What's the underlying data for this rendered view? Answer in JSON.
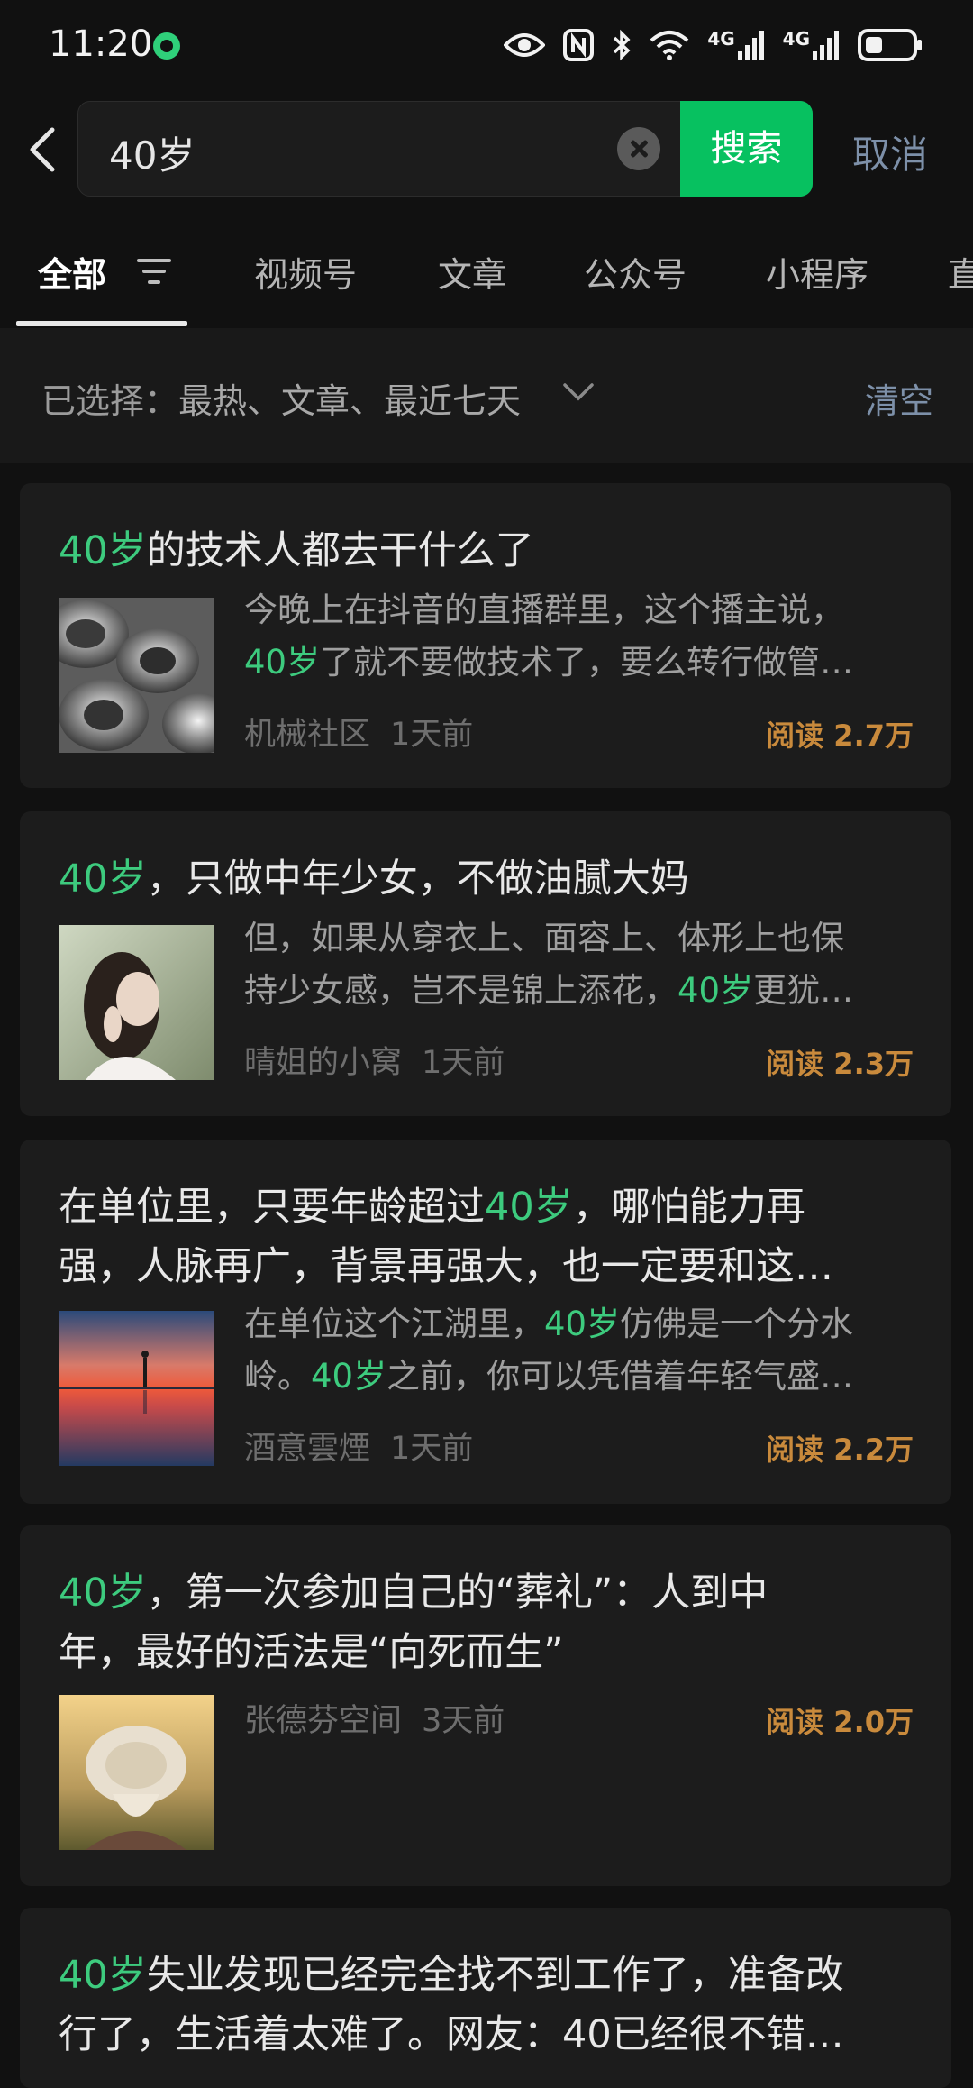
{
  "status_bar": {
    "time": "11:20",
    "network_label_1": "4G",
    "network_label_2": "4G"
  },
  "search": {
    "query": "40岁",
    "search_label": "搜索",
    "cancel_label": "取消"
  },
  "tabs": [
    {
      "label": "全部"
    },
    {
      "label": "视频号"
    },
    {
      "label": "文章"
    },
    {
      "label": "公众号"
    },
    {
      "label": "小程序"
    },
    {
      "label": "直"
    }
  ],
  "filter": {
    "prefix": "已选择：",
    "selected": "最热、文章、最近七天",
    "clear_label": "清空"
  },
  "articles": [
    {
      "title_hl": "40岁",
      "title_rest": "的技术人都去干什么了",
      "desc_line1": "今晚上在抖音的直播群里，这个播主说，",
      "desc_line2_hl": "40岁",
      "desc_line2_rest": "了就不要做技术了，要么转行做管…",
      "source": "机械社区",
      "time": "1天前",
      "reads": "阅读 2.7万"
    },
    {
      "title_hl": "40岁",
      "title_rest": "，只做中年少女，不做油腻大妈",
      "desc_line1": "但，如果从穿衣上、面容上、体形上也保",
      "desc_line2_pre": "持少女感，岂不是锦上添花，",
      "desc_line2_hl": "40岁",
      "desc_line2_rest": "更犹…",
      "source": "晴姐的小窝",
      "time": "1天前",
      "reads": "阅读 2.3万"
    },
    {
      "title_line1_pre": "在单位里，只要年龄超过",
      "title_line1_hl": "40岁",
      "title_line1_rest": "，哪怕能力再",
      "title_line2": "强，人脉再广，背景再强大，也一定要和这…",
      "desc_line1_pre": "在单位这个江湖里，",
      "desc_line1_hl": "40岁",
      "desc_line1_rest": "仿佛是一个分水",
      "desc_line2_pre": "岭。",
      "desc_line2_hl": "40岁",
      "desc_line2_rest": "之前，你可以凭借着年轻气盛…",
      "source": "酒意雲煙",
      "time": "1天前",
      "reads": "阅读 2.2万"
    },
    {
      "title_line1_hl": "40岁",
      "title_line1_rest": "，第一次参加自己的“葬礼”：人到中",
      "title_line2": "年，最好的活法是“向死而生”",
      "source": "张德芬空间",
      "time": "3天前",
      "reads": "阅读 2.0万"
    },
    {
      "title_line1_hl": "40岁",
      "title_line1_rest": "失业发现已经完全找不到工作了，准备改",
      "title_line2": "行了，生活着太难了。网友：40已经很不错…"
    }
  ],
  "colors": {
    "accent_green": "#07c160",
    "highlight_green": "#3dcb7e",
    "reads_orange": "#c98a3c",
    "link_blue": "#7d90a9"
  }
}
